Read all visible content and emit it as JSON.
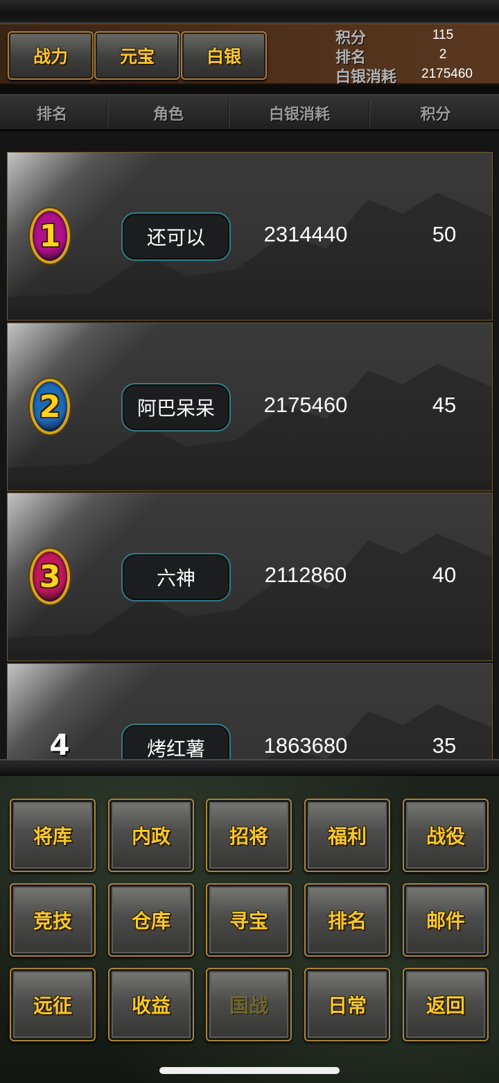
{
  "header": {
    "tabs": [
      {
        "label": "战力"
      },
      {
        "label": "元宝"
      },
      {
        "label": "白银"
      }
    ],
    "stats": {
      "score_label": "积分",
      "score_value": "115",
      "rank_label": "排名",
      "rank_value": "2",
      "silver_label": "白银消耗",
      "silver_value": "2175460"
    }
  },
  "columns": {
    "rank": "排名",
    "role": "角色",
    "silver": "白银消耗",
    "score": "积分"
  },
  "rows": [
    {
      "rank": "1",
      "name": "还可以",
      "silver": "2314440",
      "score": "50",
      "medal_color": "#b0108a"
    },
    {
      "rank": "2",
      "name": "阿巴呆呆",
      "silver": "2175460",
      "score": "45",
      "medal_color": "#1c6ab8"
    },
    {
      "rank": "3",
      "name": "六神",
      "silver": "2112860",
      "score": "40",
      "medal_color": "#c2185b"
    },
    {
      "rank": "4",
      "name": "烤红薯",
      "silver": "1863680",
      "score": "35"
    }
  ],
  "menu": [
    {
      "label": "将库"
    },
    {
      "label": "内政"
    },
    {
      "label": "招将"
    },
    {
      "label": "福利"
    },
    {
      "label": "战役"
    },
    {
      "label": "竞技"
    },
    {
      "label": "仓库"
    },
    {
      "label": "寻宝"
    },
    {
      "label": "排名"
    },
    {
      "label": "邮件"
    },
    {
      "label": "远征"
    },
    {
      "label": "收益"
    },
    {
      "label": "国战",
      "disabled": true
    },
    {
      "label": "日常"
    },
    {
      "label": "返回"
    }
  ]
}
